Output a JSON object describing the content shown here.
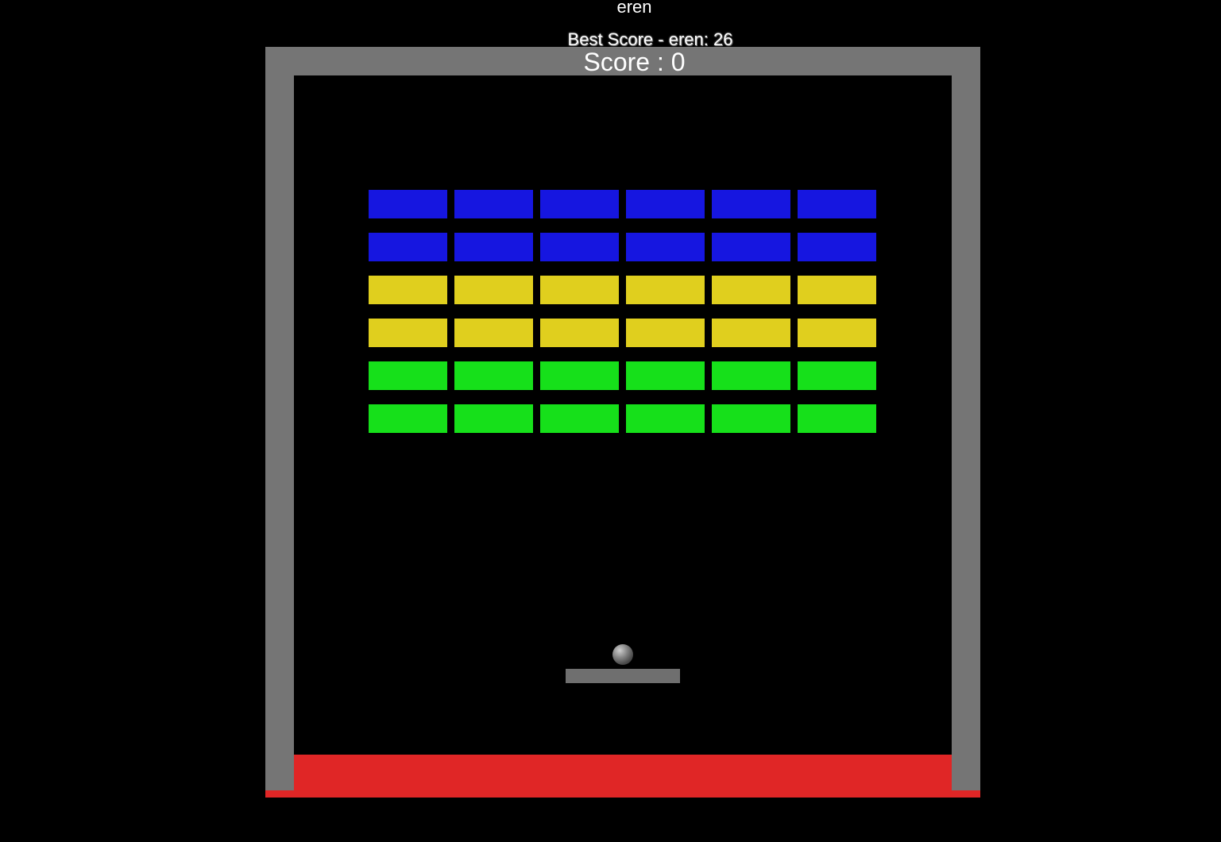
{
  "hud": {
    "player_name": "eren",
    "best_score_text": "Best Score - eren: 26",
    "score_text": "Score : 0"
  },
  "colors": {
    "background": "#000000",
    "wall": "#757575",
    "floor_zone": "#e02626",
    "paddle": "#6f6f6f",
    "brick_blue": "#1616e0",
    "brick_yellow": "#e0cf1e",
    "brick_green": "#16e01a"
  },
  "bricks": {
    "columns": 6,
    "rows": [
      "blue",
      "blue",
      "yellow",
      "yellow",
      "green",
      "green"
    ]
  }
}
